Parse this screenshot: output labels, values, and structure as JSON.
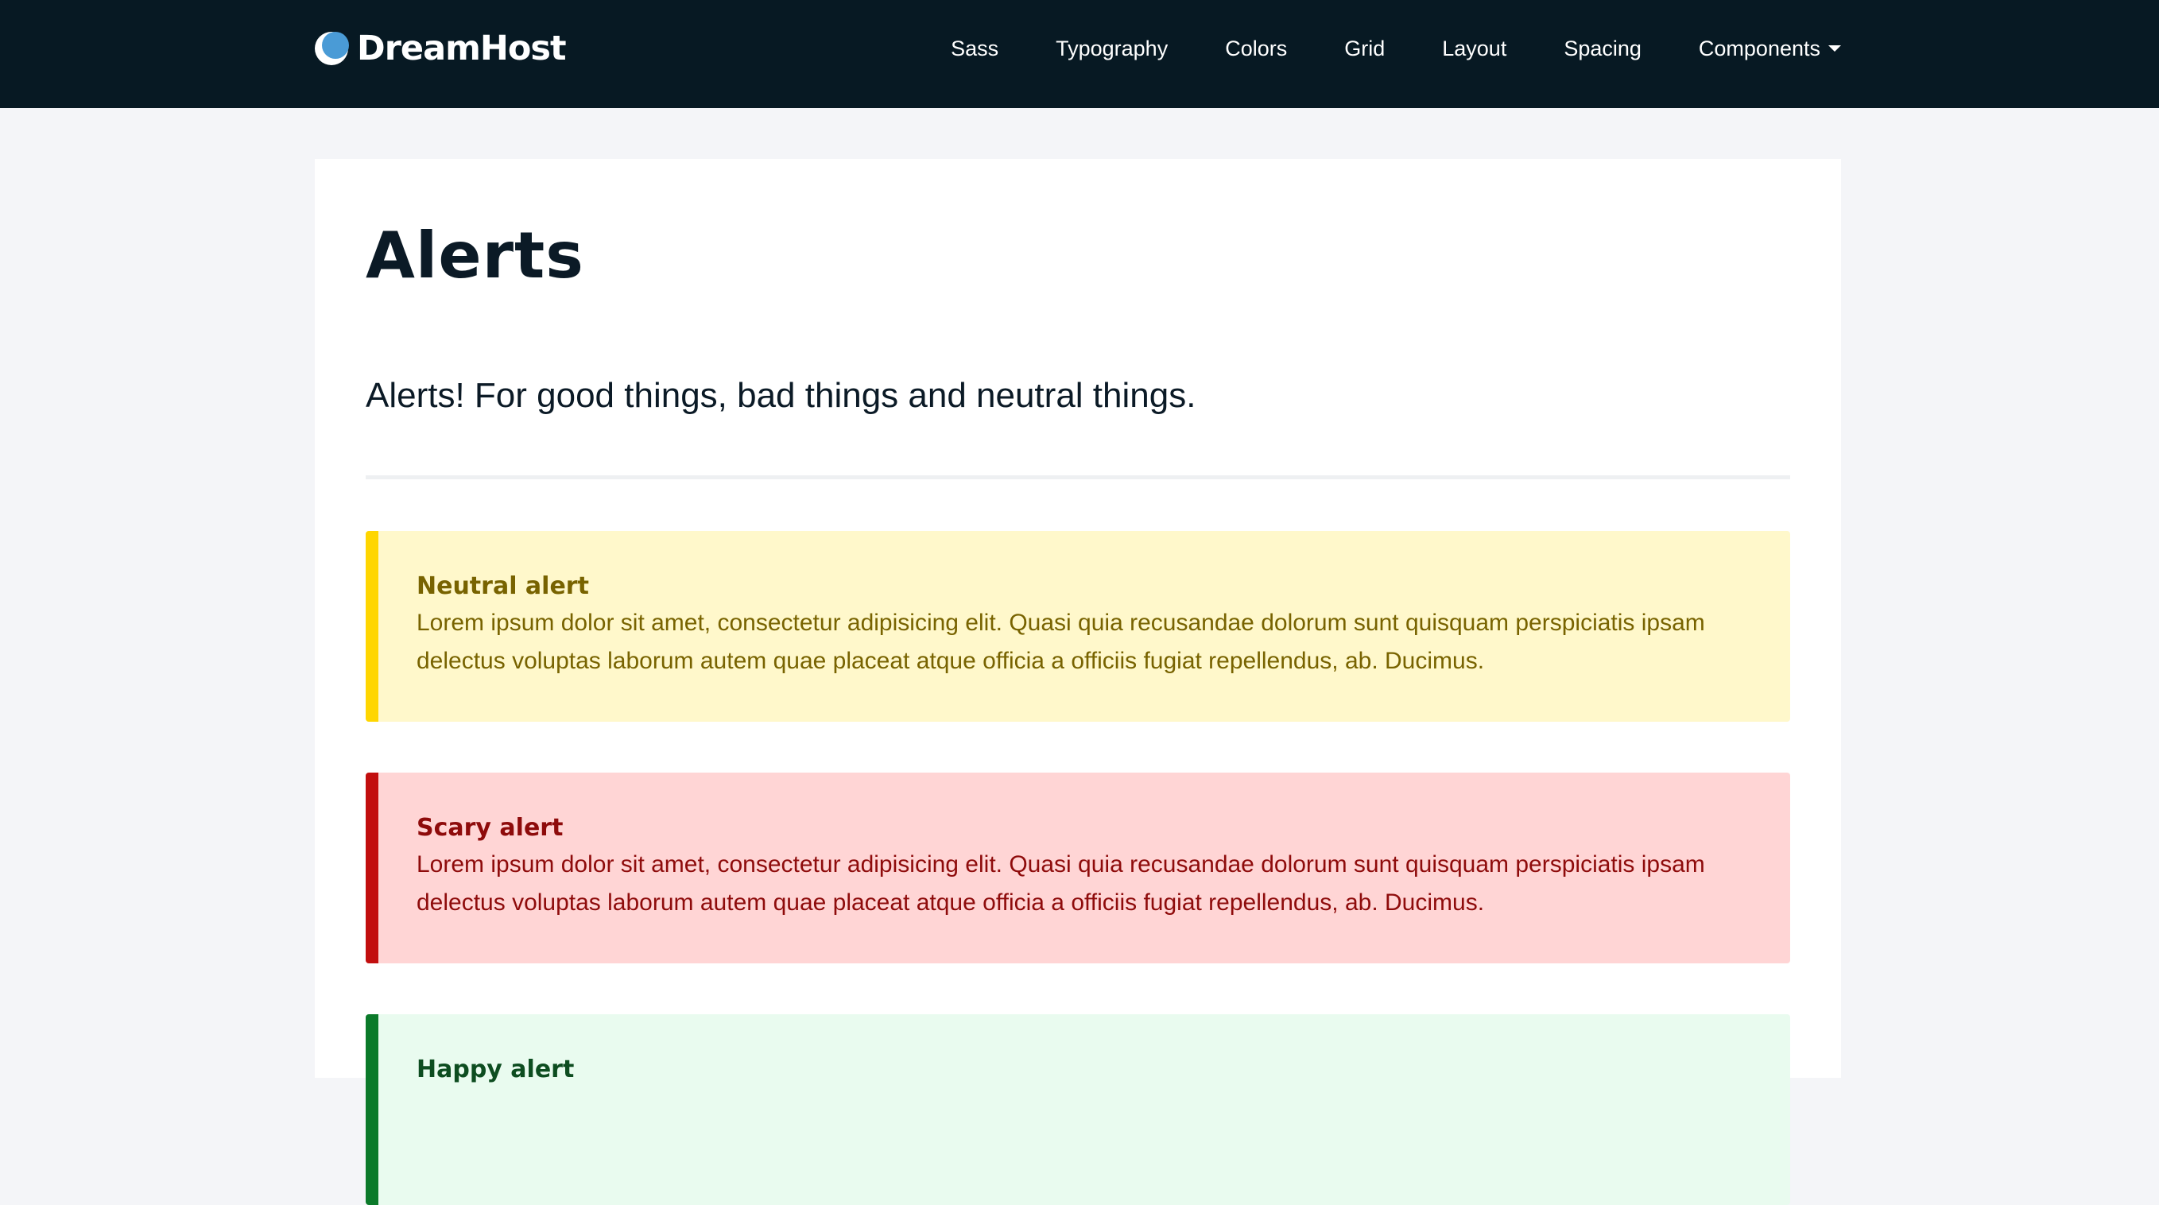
{
  "brand": {
    "name": "DreamHost",
    "logo_icon": "moon-logo-icon",
    "logo_colors": {
      "outer": "#ffffff",
      "inner": "#4a9bd6"
    }
  },
  "nav": {
    "items": [
      {
        "label": "Sass"
      },
      {
        "label": "Typography"
      },
      {
        "label": "Colors"
      },
      {
        "label": "Grid"
      },
      {
        "label": "Layout"
      },
      {
        "label": "Spacing"
      },
      {
        "label": "Components",
        "icon": "chevron-down-icon"
      }
    ]
  },
  "main": {
    "title": "Alerts",
    "lead": "Alerts! For good things, bad things and neutral things."
  },
  "alerts": [
    {
      "type": "neutral",
      "title": "Neutral alert",
      "body": "Lorem ipsum dolor sit amet, consectetur adipisicing elit. Quasi quia recusandae dolorum sunt quisquam perspiciatis ipsam delectus voluptas laborum autem quae placeat atque officia a officiis fugiat repellendus, ab. Ducimus.",
      "colors": {
        "background": "#fff8cb",
        "accent": "#ffd600",
        "text": "#786300"
      }
    },
    {
      "type": "scary",
      "title": "Scary alert",
      "body": "Lorem ipsum dolor sit amet, consectetur adipisicing elit. Quasi quia recusandae dolorum sunt quisquam perspiciatis ipsam delectus voluptas laborum autem quae placeat atque officia a officiis fugiat repellendus, ab. Ducimus.",
      "colors": {
        "background": "#ffd5d5",
        "accent": "#c20e0e",
        "text": "#8e0b0b"
      }
    },
    {
      "type": "happy",
      "title": "Happy alert",
      "body": "",
      "colors": {
        "background": "#e9fbef",
        "accent": "#0b7a2a",
        "text": "#0d4d20"
      }
    }
  ],
  "theme": {
    "topbar_background": "#071923",
    "page_background": "#f4f5f8",
    "panel_background": "#ffffff",
    "text": "#0b1a26"
  }
}
